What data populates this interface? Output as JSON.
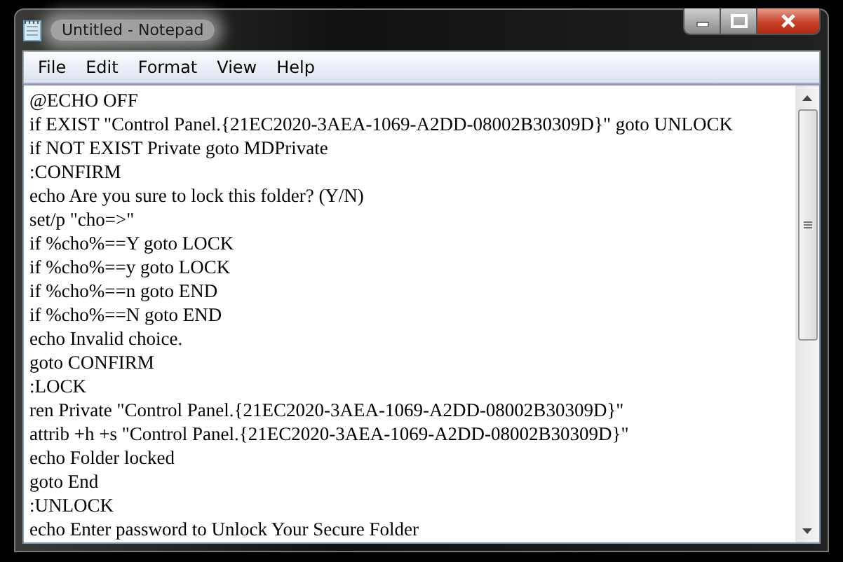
{
  "window": {
    "title": "Untitled - Notepad"
  },
  "menu": [
    "File",
    "Edit",
    "Format",
    "View",
    "Help"
  ],
  "lines": [
    "@ECHO OFF",
    "if EXIST \"Control Panel.{21EC2020-3AEA-1069-A2DD-08002B30309D}\" goto UNLOCK",
    "if NOT EXIST Private goto MDPrivate",
    ":CONFIRM",
    "echo Are you sure to lock this folder? (Y/N)",
    "set/p \"cho=>\"",
    "if %cho%==Y goto LOCK",
    "if %cho%==y goto LOCK",
    "if %cho%==n goto END",
    "if %cho%==N goto END",
    "echo Invalid choice.",
    "goto CONFIRM",
    ":LOCK",
    "ren Private \"Control Panel.{21EC2020-3AEA-1069-A2DD-08002B30309D}\"",
    "attrib +h +s \"Control Panel.{21EC2020-3AEA-1069-A2DD-08002B30309D}\"",
    "echo Folder locked",
    "goto End",
    ":UNLOCK",
    "echo Enter password to Unlock Your Secure Folder"
  ]
}
